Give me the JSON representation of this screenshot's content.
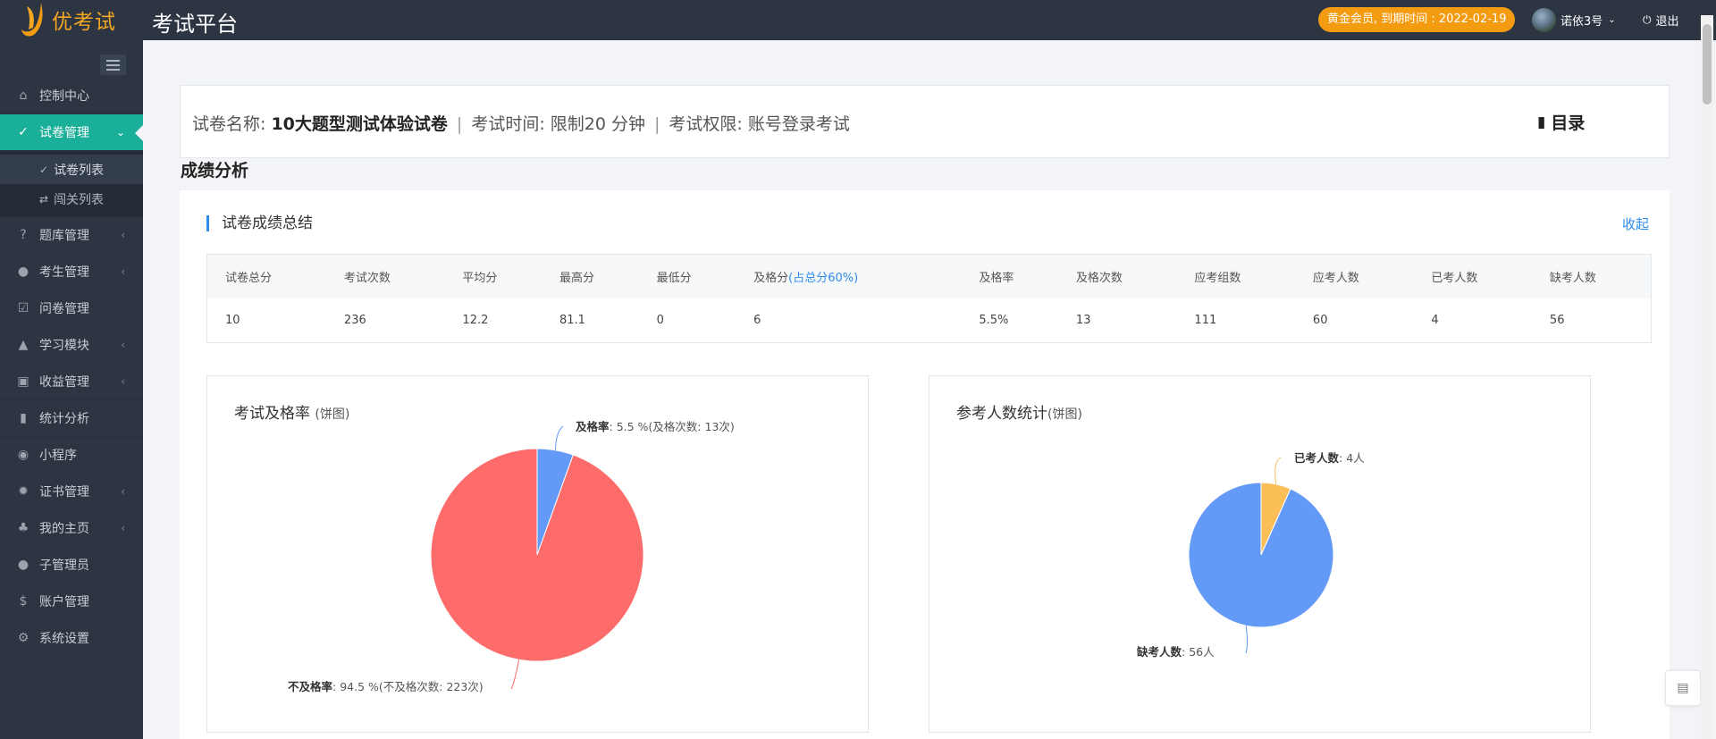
{
  "header": {
    "logo_text": "优考试",
    "platform_title": "考试平台",
    "member_badge": "黄金会员, 到期时间 : 2022-02-19",
    "user_name": "诺依3号",
    "logout_label": "退出"
  },
  "sidebar": {
    "items": [
      {
        "label": "控制中心",
        "icon": "home-icon"
      },
      {
        "label": "试卷管理",
        "icon": "check-circle-icon"
      },
      {
        "label": "试卷列表",
        "icon": "check-circle-icon"
      },
      {
        "label": "闯关列表",
        "icon": "shuffle-icon"
      },
      {
        "label": "题库管理",
        "icon": "question-circle-icon"
      },
      {
        "label": "考生管理",
        "icon": "user-icon"
      },
      {
        "label": "问卷管理",
        "icon": "checkbox-icon"
      },
      {
        "label": "学习模块",
        "icon": "graduation-cap-icon"
      },
      {
        "label": "收益管理",
        "icon": "money-icon"
      },
      {
        "label": "统计分析",
        "icon": "bar-chart-icon"
      },
      {
        "label": "小程序",
        "icon": "wechat-icon"
      },
      {
        "label": "证书管理",
        "icon": "certificate-icon"
      },
      {
        "label": "我的主页",
        "icon": "tree-icon"
      },
      {
        "label": "子管理员",
        "icon": "user-icon"
      },
      {
        "label": "账户管理",
        "icon": "dollar-icon"
      },
      {
        "label": "系统设置",
        "icon": "gear-icon"
      }
    ]
  },
  "paper": {
    "name_label": "试卷名称: ",
    "name": "10大题型测试体验试卷",
    "time_label": "考试时间: 限制20 分钟",
    "permission_label": "考试权限: 账号登录考试",
    "toc_label": "目录"
  },
  "section_title": "成绩分析",
  "summary": {
    "title": "试卷成绩总结",
    "collapse_label": "收起",
    "headers": [
      "试卷总分",
      "考试次数",
      "平均分",
      "最高分",
      "最低分",
      "及格分",
      "及格率",
      "及格次数",
      "应考组数",
      "应考人数",
      "已考人数",
      "缺考人数"
    ],
    "pass_score_note": "(占总分60%)",
    "values": [
      "10",
      "236",
      "12.2",
      "81.1",
      "0",
      "6",
      "5.5%",
      "13",
      "111",
      "60",
      "4",
      "56"
    ]
  },
  "chart_data": [
    {
      "type": "pie",
      "title": "考试及格率",
      "subtitle": "(饼图)",
      "slices": [
        {
          "name": "及格率",
          "value": 5.5,
          "detail": ": 5.5 %(及格次数: 13次)",
          "color": "#6399f7"
        },
        {
          "name": "不及格率",
          "value": 94.5,
          "detail": ": 94.5 %(不及格次数: 223次)",
          "color": "#fd6b6b"
        }
      ]
    },
    {
      "type": "pie",
      "title": "参考人数统计",
      "subtitle": "(饼图)",
      "slices": [
        {
          "name": "已考人数",
          "value": 4,
          "detail": ": 4人",
          "color": "#fcbe57"
        },
        {
          "name": "缺考人数",
          "value": 56,
          "detail": ": 56人",
          "color": "#6399f7"
        }
      ]
    }
  ]
}
